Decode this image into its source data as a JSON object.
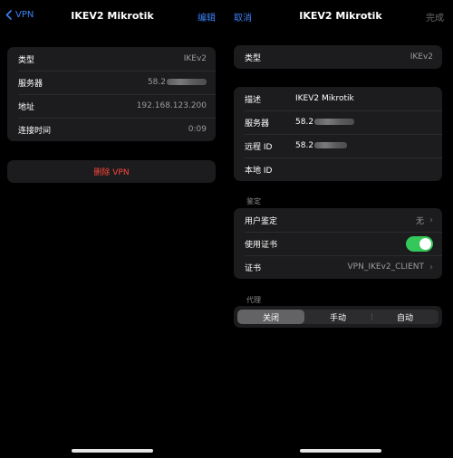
{
  "left": {
    "nav": {
      "back_label": "VPN",
      "title": "IKEV2 Mikrotik",
      "edit_label": "编辑"
    },
    "info_rows": [
      {
        "label": "类型",
        "value": "IKEv2"
      },
      {
        "label": "服务器",
        "value": "58.2"
      },
      {
        "label": "地址",
        "value": "192.168.123.200"
      },
      {
        "label": "连接时间",
        "value": "0:09"
      }
    ],
    "delete_label": "删除 VPN"
  },
  "right": {
    "nav": {
      "cancel_label": "取消",
      "title": "IKEV2 Mikrotik",
      "done_label": "完成"
    },
    "type_row": {
      "label": "类型",
      "value": "IKEv2"
    },
    "config_rows": [
      {
        "label": "描述",
        "value": "IKEV2 Mikrotik"
      },
      {
        "label": "服务器",
        "value": "58.2"
      },
      {
        "label": "远程 ID",
        "value": "58.2"
      },
      {
        "label": "本地 ID",
        "value": ""
      }
    ],
    "auth_section_title": "鉴定",
    "auth_rows": {
      "user_auth": {
        "label": "用户鉴定",
        "value": "无"
      },
      "use_cert": {
        "label": "使用证书"
      },
      "cert": {
        "label": "证书",
        "value": "VPN_IKEv2_CLIENT"
      }
    },
    "proxy_section_title": "代理",
    "proxy_options": [
      "关闭",
      "手动",
      "自动"
    ]
  },
  "colors": {
    "accent": "#3b82f6",
    "destructive": "#ff453a",
    "toggle_on": "#34c759",
    "card_bg": "#1c1c1e"
  }
}
